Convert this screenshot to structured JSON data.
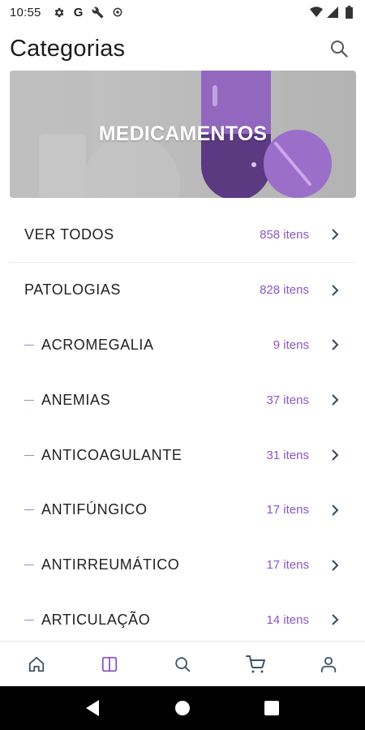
{
  "status_bar": {
    "time": "10:55",
    "left_icons": [
      "settings-gear-icon",
      "google-g-icon",
      "wrench-icon",
      "settings-outline-icon"
    ],
    "right_icons": [
      "wifi-icon",
      "signal-icon",
      "battery-icon"
    ],
    "google_glyph": "G"
  },
  "header": {
    "title": "Categorias",
    "search_icon": "search-icon"
  },
  "banner": {
    "title": "MEDICAMENTOS",
    "pill_color": "#8a5bbf"
  },
  "categories": [
    {
      "label": "VER TODOS",
      "count": "858 itens",
      "sub": false
    },
    {
      "label": "PATOLOGIAS",
      "count": "828 itens",
      "sub": false
    },
    {
      "label": "ACROMEGALIA",
      "count": "9 itens",
      "sub": true
    },
    {
      "label": "ANEMIAS",
      "count": "37 itens",
      "sub": true
    },
    {
      "label": "ANTICOAGULANTE",
      "count": "31 itens",
      "sub": true
    },
    {
      "label": "ANTIFÚNGICO",
      "count": "17 itens",
      "sub": true
    },
    {
      "label": "ANTIRREUMÁTICO",
      "count": "17 itens",
      "sub": true
    },
    {
      "label": "ARTICULAÇÃO",
      "count": "14 itens",
      "sub": true
    }
  ],
  "bottom_nav": [
    {
      "name": "home",
      "icon": "home-icon",
      "active": false
    },
    {
      "name": "categories",
      "icon": "columns-icon",
      "active": true
    },
    {
      "name": "search",
      "icon": "search-icon",
      "active": false
    },
    {
      "name": "cart",
      "icon": "cart-icon",
      "active": false
    },
    {
      "name": "profile",
      "icon": "user-icon",
      "active": false
    }
  ],
  "colors": {
    "accent": "#8a56c9",
    "chevron": "#2f4a5a",
    "nav_icon": "#3b5466",
    "nav_active": "#8a56c9"
  },
  "system_nav": [
    "back-icon",
    "home-circle-icon",
    "recents-icon"
  ]
}
